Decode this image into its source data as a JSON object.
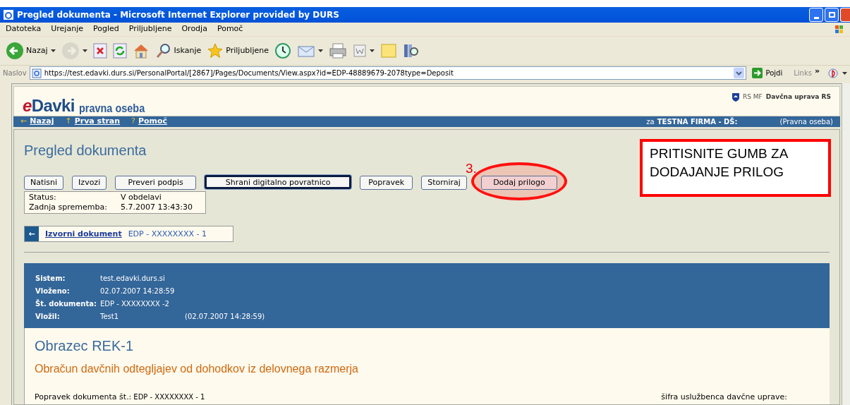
{
  "window": {
    "title": "Pregled dokumenta - Microsoft Internet Explorer provided by DURS"
  },
  "menu": [
    "Datoteka",
    "Urejanje",
    "Pogled",
    "Priljubljene",
    "Orodja",
    "Pomoč"
  ],
  "toolbar": [
    {
      "kind": "back",
      "label": "Nazaj",
      "dropdown": true,
      "disabled": false
    },
    {
      "kind": "forward",
      "dropdown": true,
      "disabled": true
    },
    {
      "kind": "stop",
      "disabled": false
    },
    {
      "kind": "refresh",
      "disabled": false
    },
    {
      "kind": "home",
      "disabled": false
    },
    {
      "kind": "search",
      "label": "Iskanje",
      "disabled": false
    },
    {
      "kind": "favorites",
      "label": "Priljubljene",
      "disabled": false
    },
    {
      "kind": "history",
      "disabled": false
    },
    {
      "kind": "mail",
      "dropdown": true,
      "disabled": false
    },
    {
      "kind": "print",
      "disabled": false
    },
    {
      "kind": "word",
      "dropdown": true,
      "disabled": false
    },
    {
      "kind": "notes",
      "disabled": false
    },
    {
      "kind": "research",
      "disabled": false
    }
  ],
  "address": {
    "label": "Naslov",
    "value": "https://test.edavki.durs.si/PersonalPortal/[2867]/Pages/Documents/View.aspx?id=EDP-48889679-2078type=Deposit",
    "go": "Pojdi",
    "links": "Links",
    "more": "»"
  },
  "site": {
    "logo_e": "e",
    "logo_main": "Davki",
    "logo_sub": "pravna oseba",
    "authority_prefix": "RS MF",
    "authority": "Davčna uprava RS",
    "nav": [
      {
        "icon": "←",
        "label": "Nazaj"
      },
      {
        "icon": "↑",
        "label": "Prva stran"
      },
      {
        "icon": "?",
        "label": "Pomoč"
      }
    ],
    "user_prefix": "za",
    "user": "TESTNA FIRMA - DŠ:",
    "user_type": "(Pravna oseba)"
  },
  "page_title": "Pregled dokumenta",
  "buttons": [
    {
      "label": "Natisni",
      "focused": false,
      "highlighted": false
    },
    {
      "label": "Izvozi",
      "focused": false,
      "highlighted": false
    },
    {
      "label": "Preveri podpis",
      "focused": false,
      "highlighted": false
    },
    {
      "label": "Shrani digitalno povratnico",
      "focused": true,
      "highlighted": false
    },
    {
      "label": "Popravek",
      "focused": false,
      "highlighted": false
    },
    {
      "label": "Storniraj",
      "focused": false,
      "highlighted": false
    },
    {
      "label": "Dodaj prilogo",
      "focused": false,
      "highlighted": true
    }
  ],
  "status": [
    {
      "label": "Status:",
      "value": "V obdelavi"
    },
    {
      "label": "Zadnja sprememba:",
      "value": "5.7.2007 13:43:30"
    }
  ],
  "source_document": {
    "icon": "←",
    "link": "Izvorni dokument",
    "value": "EDP - XXXXXXXX - 1"
  },
  "annotation": {
    "step": "3.",
    "note_lines": [
      "PRITISNITE GUMB ZA",
      "DODAJANJE PRILOG"
    ]
  },
  "info": [
    {
      "label": "Sistem:",
      "value": "test.edavki.durs.si"
    },
    {
      "label": "Vloženo:",
      "value": "02.07.2007 14:28:59"
    },
    {
      "label": "Št. dokumenta:",
      "value": "EDP - XXXXXXXX -2"
    },
    {
      "label": "Vložil:",
      "value": "Test1",
      "extra": "(02.07.2007 14:28:59)"
    }
  ],
  "form": {
    "title": "Obrazec REK-1",
    "subtitle": "Obračun davčnih odtegljajev od dohodkov iz delovnega razmerja",
    "correction_label": "Popravek dokumenta št.:",
    "correction_value": "EDP - XXXXXXXX - 1",
    "officer_label": "šifra uslužbenca davčne uprave:"
  }
}
